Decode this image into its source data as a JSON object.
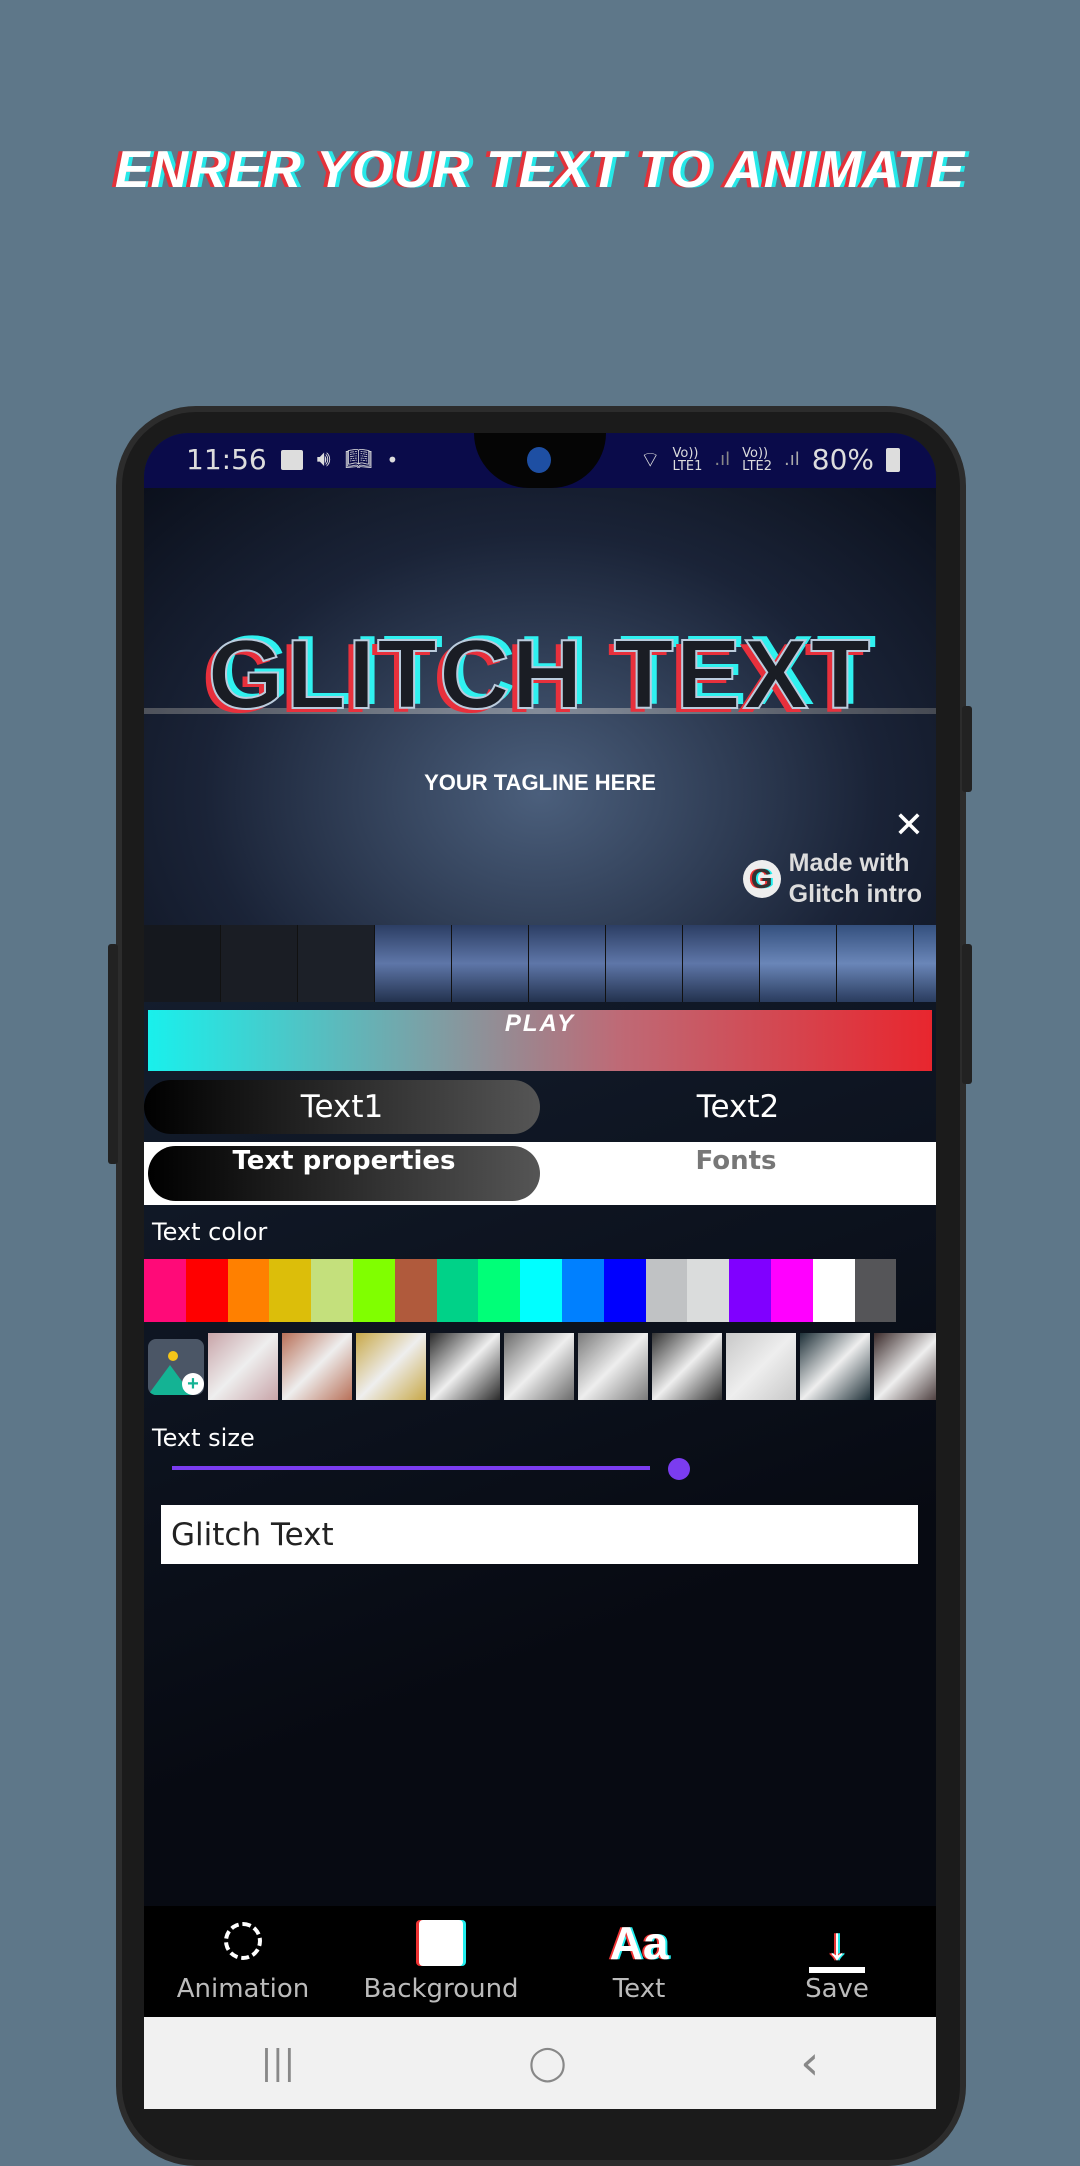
{
  "headline": "ENRER YOUR TEXT TO ANIMATE",
  "status": {
    "time": "11:56",
    "lte1": "LTE1",
    "lte2": "LTE2",
    "volte": "Vo))",
    "battery": "80%"
  },
  "preview": {
    "title": "GLITCH TEXT",
    "tagline": "YOUR TAGLINE HERE",
    "watermark_line1": "Made with",
    "watermark_line2": "Glitch intro",
    "logo_letter": "G"
  },
  "play_label": "PLAY",
  "text_tabs": [
    {
      "label": "Text1",
      "selected": true
    },
    {
      "label": "Text2",
      "selected": false
    }
  ],
  "property_tabs": [
    {
      "label": "Text properties",
      "selected": true
    },
    {
      "label": "Fonts",
      "selected": false
    }
  ],
  "text_color_label": "Text color",
  "colors": [
    "#ff0a78",
    "#ff0000",
    "#ff8000",
    "#dcbe0a",
    "#c4e07c",
    "#80ff00",
    "#b05a3c",
    "#00d288",
    "#00ff78",
    "#00ffff",
    "#0080ff",
    "#0000ff",
    "#c0c2c4",
    "#dadcdc",
    "#8000ff",
    "#ff00ff",
    "#ffffff",
    "#555558"
  ],
  "textures": [
    "#c8a4a8",
    "#b87058",
    "#c8a848",
    "#2a2a2a",
    "#6a6a6a",
    "#7a7a7a",
    "#333333",
    "#c8c8c8",
    "#1e3038",
    "#3a2a2a"
  ],
  "text_size_label": "Text size",
  "text_size_value": 0.64,
  "text_input_value": "Glitch Text",
  "bottom_nav": [
    {
      "label": "Animation",
      "icon": "timer-icon"
    },
    {
      "label": "Background",
      "icon": "image-icon"
    },
    {
      "label": "Text",
      "icon": "font-icon",
      "glyph": "Aa"
    },
    {
      "label": "Save",
      "icon": "download-icon"
    }
  ],
  "system_nav": {
    "recents": "|||",
    "home": "◯",
    "back": "‹"
  }
}
